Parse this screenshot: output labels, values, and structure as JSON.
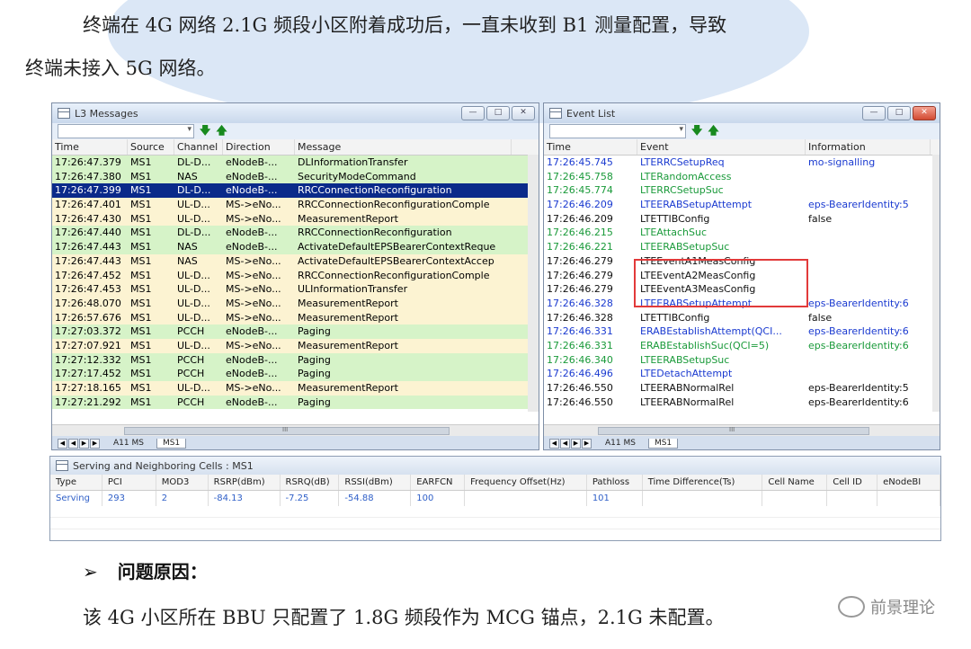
{
  "text": {
    "para1": "终端在 4G 网络 2.1G 频段小区附着成功后，一直未收到 B1 测量配置，导致",
    "para2": "终端未接入 5G 网络。",
    "bullet_mark": "➢",
    "bullet": "问题原因：",
    "para3": "该 4G 小区所在 BBU 只配置了 1.8G 频段作为 MCG 锚点，2.1G 未配置。",
    "watermark": "前景理论"
  },
  "l3": {
    "title": "L3 Messages",
    "filter_value": "",
    "headers": [
      "Time",
      "Source",
      "Channel",
      "Direction",
      "Message"
    ],
    "rows": [
      {
        "time": "17:26:47.379",
        "source": "MS1",
        "channel": "DL-D...",
        "direction": "eNodeB-...",
        "message": "DLInformationTransfer",
        "style": "g"
      },
      {
        "time": "17:26:47.380",
        "source": "MS1",
        "channel": "NAS",
        "direction": "eNodeB-...",
        "message": "SecurityModeCommand",
        "style": "g"
      },
      {
        "time": "17:26:47.399",
        "source": "MS1",
        "channel": "DL-D...",
        "direction": "eNodeB-...",
        "message": "RRCConnectionReconfiguration",
        "style": "sel"
      },
      {
        "time": "17:26:47.401",
        "source": "MS1",
        "channel": "UL-D...",
        "direction": "MS->eNo...",
        "message": "RRCConnectionReconfigurationComple",
        "style": "y"
      },
      {
        "time": "17:26:47.430",
        "source": "MS1",
        "channel": "UL-D...",
        "direction": "MS->eNo...",
        "message": "MeasurementReport",
        "style": "y"
      },
      {
        "time": "17:26:47.440",
        "source": "MS1",
        "channel": "DL-D...",
        "direction": "eNodeB-...",
        "message": "RRCConnectionReconfiguration",
        "style": "g"
      },
      {
        "time": "17:26:47.443",
        "source": "MS1",
        "channel": "NAS",
        "direction": "eNodeB-...",
        "message": "ActivateDefaultEPSBearerContextReque",
        "style": "g"
      },
      {
        "time": "17:26:47.443",
        "source": "MS1",
        "channel": "NAS",
        "direction": "MS->eNo...",
        "message": "ActivateDefaultEPSBearerContextAccep",
        "style": "y"
      },
      {
        "time": "17:26:47.452",
        "source": "MS1",
        "channel": "UL-D...",
        "direction": "MS->eNo...",
        "message": "RRCConnectionReconfigurationComple",
        "style": "y"
      },
      {
        "time": "17:26:47.453",
        "source": "MS1",
        "channel": "UL-D...",
        "direction": "MS->eNo...",
        "message": "ULInformationTransfer",
        "style": "y"
      },
      {
        "time": "17:26:48.070",
        "source": "MS1",
        "channel": "UL-D...",
        "direction": "MS->eNo...",
        "message": "MeasurementReport",
        "style": "y"
      },
      {
        "time": "17:26:57.676",
        "source": "MS1",
        "channel": "UL-D...",
        "direction": "MS->eNo...",
        "message": "MeasurementReport",
        "style": "y"
      },
      {
        "time": "17:27:03.372",
        "source": "MS1",
        "channel": "PCCH",
        "direction": "eNodeB-...",
        "message": "Paging",
        "style": "g"
      },
      {
        "time": "17:27:07.921",
        "source": "MS1",
        "channel": "UL-D...",
        "direction": "MS->eNo...",
        "message": "MeasurementReport",
        "style": "y"
      },
      {
        "time": "17:27:12.332",
        "source": "MS1",
        "channel": "PCCH",
        "direction": "eNodeB-...",
        "message": "Paging",
        "style": "g"
      },
      {
        "time": "17:27:17.452",
        "source": "MS1",
        "channel": "PCCH",
        "direction": "eNodeB-...",
        "message": "Paging",
        "style": "g"
      },
      {
        "time": "17:27:18.165",
        "source": "MS1",
        "channel": "UL-D...",
        "direction": "MS->eNo...",
        "message": "MeasurementReport",
        "style": "y"
      },
      {
        "time": "17:27:21.292",
        "source": "MS1",
        "channel": "PCCH",
        "direction": "eNodeB-...",
        "message": "Paging",
        "style": "g"
      }
    ],
    "scroll_label": "III",
    "tabs": [
      "A11 MS",
      "MS1"
    ],
    "active_tab": 1
  },
  "events": {
    "title": "Event List",
    "filter_value": "",
    "headers": [
      "Time",
      "Event",
      "Information"
    ],
    "rows": [
      {
        "time": "17:26:45.745",
        "event": "LTERRCSetupReq",
        "info": "mo-signalling",
        "color": "blue"
      },
      {
        "time": "17:26:45.758",
        "event": "LTERandomAccess",
        "info": "",
        "color": "green"
      },
      {
        "time": "17:26:45.774",
        "event": "LTERRCSetupSuc",
        "info": "",
        "color": "green"
      },
      {
        "time": "17:26:46.209",
        "event": "LTEERABSetupAttempt",
        "info": "eps-BearerIdentity:5",
        "color": "blue"
      },
      {
        "time": "17:26:46.209",
        "event": "LTETTIBConfig",
        "info": "false",
        "color": "black"
      },
      {
        "time": "17:26:46.215",
        "event": "LTEAttachSuc",
        "info": "",
        "color": "green"
      },
      {
        "time": "17:26:46.221",
        "event": "LTEERABSetupSuc",
        "info": "",
        "color": "green"
      },
      {
        "time": "17:26:46.279",
        "event": "LTEEventA1MeasConfig",
        "info": "",
        "color": "black"
      },
      {
        "time": "17:26:46.279",
        "event": "LTEEventA2MeasConfig",
        "info": "",
        "color": "black"
      },
      {
        "time": "17:26:46.279",
        "event": "LTEEventA3MeasConfig",
        "info": "",
        "color": "black"
      },
      {
        "time": "17:26:46.328",
        "event": "LTEERABSetupAttempt",
        "info": "eps-BearerIdentity:6",
        "color": "blue"
      },
      {
        "time": "17:26:46.328",
        "event": "LTETTIBConfig",
        "info": "false",
        "color": "black"
      },
      {
        "time": "17:26:46.331",
        "event": "ERABEstablishAttempt(QCI...",
        "info": "eps-BearerIdentity:6",
        "color": "blue"
      },
      {
        "time": "17:26:46.331",
        "event": "ERABEstablishSuc(QCI=5)",
        "info": "eps-BearerIdentity:6",
        "color": "green"
      },
      {
        "time": "17:26:46.340",
        "event": "LTEERABSetupSuc",
        "info": "",
        "color": "green"
      },
      {
        "time": "17:26:46.496",
        "event": "LTEDetachAttempt",
        "info": "",
        "color": "blue"
      },
      {
        "time": "17:26:46.550",
        "event": "LTEERABNormalRel",
        "info": "eps-BearerIdentity:5",
        "color": "black"
      },
      {
        "time": "17:26:46.550",
        "event": "LTEERABNormalRel",
        "info": "eps-BearerIdentity:6",
        "color": "black"
      }
    ],
    "scroll_label": "III",
    "tabs": [
      "A11 MS",
      "MS1"
    ],
    "active_tab": 1
  },
  "cells": {
    "title": "Serving and Neighboring Cells : MS1",
    "headers": [
      "Type",
      "PCI",
      "MOD3",
      "RSRP(dBm)",
      "RSRQ(dB)",
      "RSSI(dBm)",
      "EARFCN",
      "Frequency Offset(Hz)",
      "Pathloss",
      "Time Difference(Ts)",
      "Cell Name",
      "Cell ID",
      "eNodeBI"
    ],
    "row": [
      "Serving",
      "293",
      "2",
      "-84.13",
      "-7.25",
      "-54.88",
      "100",
      "",
      "101",
      "",
      "",
      "",
      ""
    ]
  },
  "colors": {
    "red_box": "#e23a3a",
    "selected_row": "#0a2a8a",
    "green_row": "#d6f3c8",
    "yellow_row": "#fcf3d2",
    "blue_text": "#1a3ad0",
    "green_text": "#1a9a3a"
  }
}
